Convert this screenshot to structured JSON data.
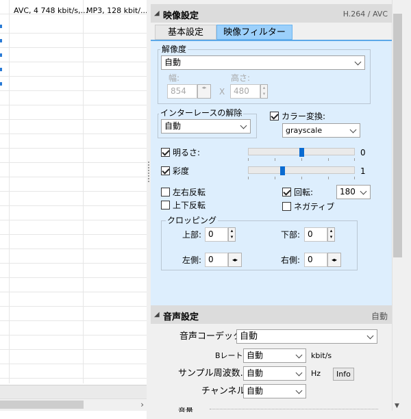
{
  "file_list": {
    "rows": [
      {
        "video": "AVC, 4 748 kbit/s,...",
        "audio": "MP3, 128 kbit/..."
      }
    ]
  },
  "video_section": {
    "title": "映像設定",
    "summary": "H.264 / AVC",
    "tabs": [
      {
        "label": "基本設定"
      },
      {
        "label": "映像フィルター"
      }
    ],
    "resolution": {
      "group_label": "解像度",
      "mode": "自動",
      "width_label": "幅:",
      "width_value": "854",
      "separator": "X",
      "height_label": "高さ:",
      "height_value": "480"
    },
    "deinterlace": {
      "group_label": "インターレースの解除",
      "value": "自動"
    },
    "color_convert": {
      "label": "カラー変換:",
      "checked": true,
      "value": "grayscale"
    },
    "brightness": {
      "label": "明るさ:",
      "checked": true,
      "value": "0",
      "level": 0.5
    },
    "saturation": {
      "label": "彩度",
      "checked": true,
      "value": "1",
      "level": 0.33
    },
    "flip_h": {
      "label": "左右反転",
      "checked": false
    },
    "flip_v": {
      "label": "上下反転",
      "checked": false
    },
    "rotate": {
      "label": "回転:",
      "checked": true,
      "value": "180"
    },
    "negative": {
      "label": "ネガティブ",
      "checked": false
    },
    "cropping": {
      "group_label": "クロッピング",
      "top_label": "上部:",
      "top_value": "0",
      "bottom_label": "下部:",
      "bottom_value": "0",
      "left_label": "左側:",
      "left_value": "0",
      "right_label": "右側:",
      "right_value": "0"
    }
  },
  "audio_section": {
    "title": "音声設定",
    "summary": "自動",
    "codec_label": "音声コーデック:",
    "codec_value": "自動",
    "bitrate_label": "Bレート:",
    "bitrate_value": "自動",
    "bitrate_unit": "kbit/s",
    "samplerate_label": "サンプル周波数.:",
    "samplerate_value": "自動",
    "samplerate_unit": "Hz",
    "info_button": "Info",
    "channel_label": "チャンネル:",
    "channel_value": "自動",
    "next_label": "音量"
  },
  "icons": [
    "collapse-triangle-icon",
    "chevron-down-icon",
    "spin-up-icon",
    "spin-down-icon",
    "scroll-right-icon",
    "scroll-down-icon",
    "check-icon"
  ],
  "colors": {
    "accent": "#0a6bd1",
    "tab_active": "#9cd0fb",
    "panel_bg": "#ddeefd"
  }
}
